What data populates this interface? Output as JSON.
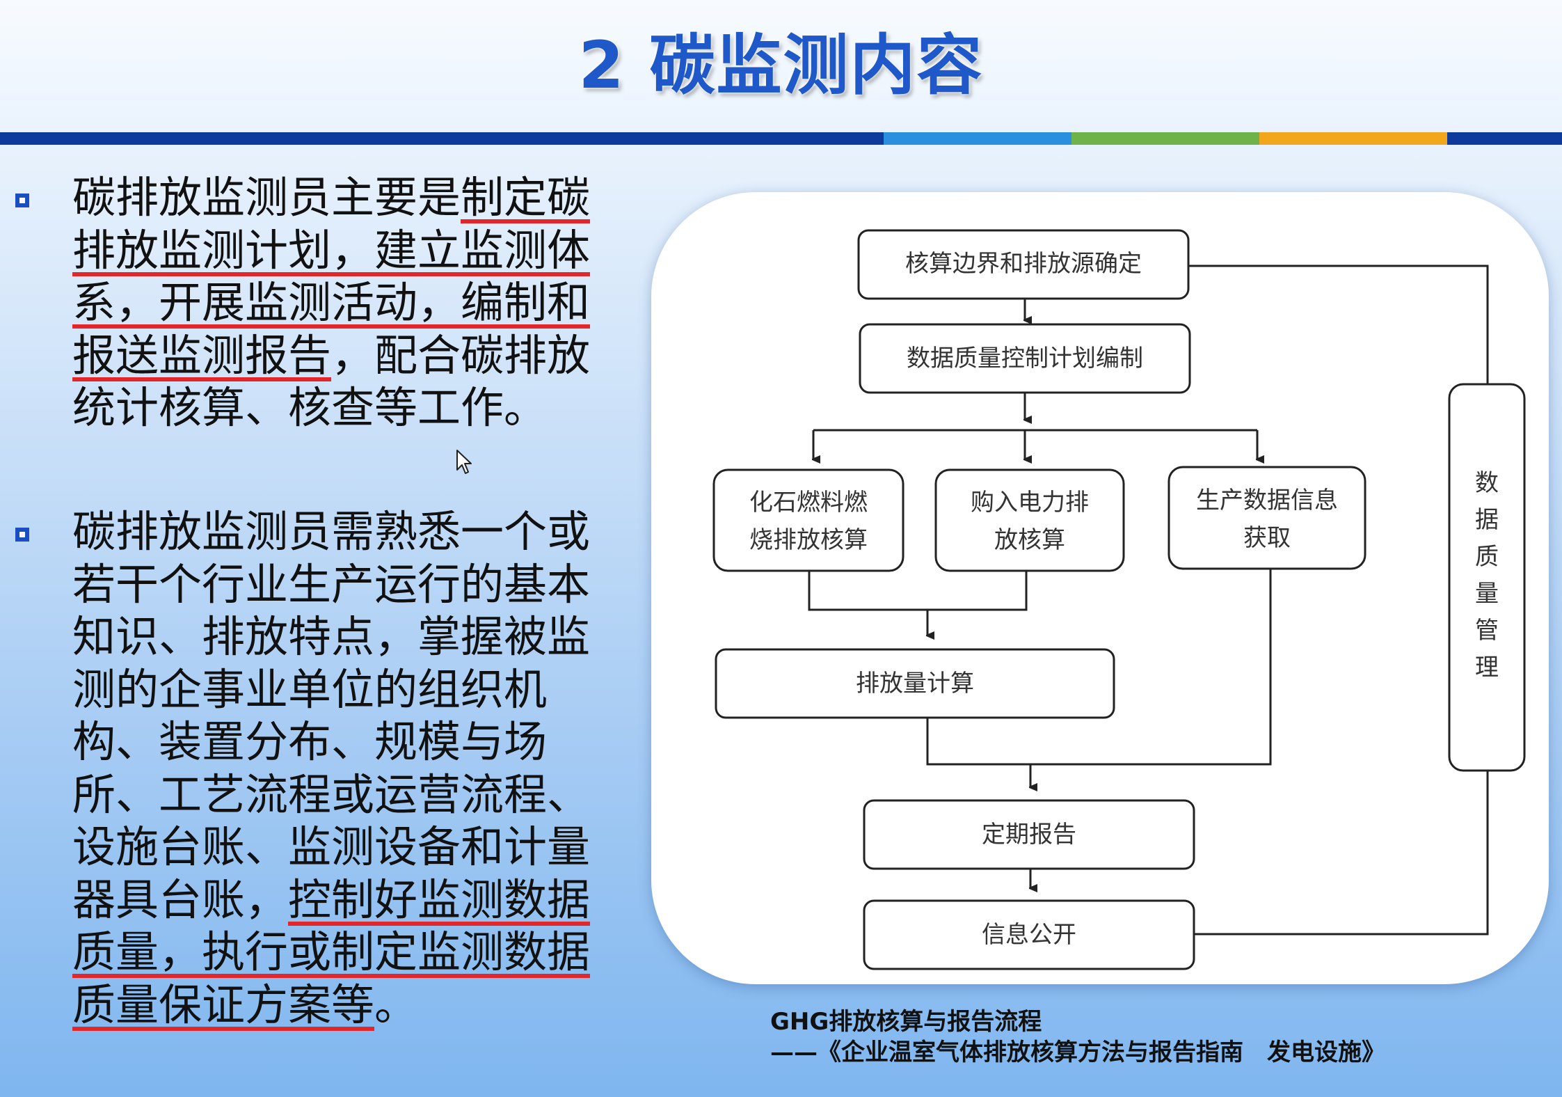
{
  "slide": {
    "title": "2 碳监测内容",
    "accent_colors": [
      "#0d3a9b",
      "#2b8fe0",
      "#6fb24a",
      "#f2a61c",
      "#0d3a9b"
    ]
  },
  "bullets": [
    {
      "segments": [
        {
          "text": "碳排放监测员主要是",
          "underline": false
        },
        {
          "text": "制定碳排放监测计划，建立监测体系，开展监测活动，编制和报送监测报告",
          "underline": true
        },
        {
          "text": "，配合碳排放统计核算、核查等工作。",
          "underline": false
        }
      ]
    },
    {
      "segments": [
        {
          "text": "碳排放监测员需熟悉一个或若干个行业生产运行的基本知识、排放特点，掌握被监测的企事业单位的组织机构、装置分布、规模与场所、工艺流程或运营流程、设施台账、监测设备和计量器具台账，",
          "underline": false
        },
        {
          "text": "控制好监测数据质量，执行或制定监测数据质量保证方案等",
          "underline": true
        },
        {
          "text": "。",
          "underline": false
        }
      ]
    }
  ],
  "flowchart": {
    "boundary": "核算边界和排放源确定",
    "plan": "数据质量控制计划编制",
    "fossil": [
      "化石燃料燃",
      "烧排放核算"
    ],
    "power": [
      "购入电力排",
      "放核算"
    ],
    "production": [
      "生产数据信息",
      "获取"
    ],
    "emission_calc": "排放量计算",
    "periodic_report": "定期报告",
    "disclosure": "信息公开",
    "quality_mgmt": [
      "数",
      "据",
      "质",
      "量",
      "管",
      "理"
    ]
  },
  "caption": {
    "line1": "GHG排放核算与报告流程",
    "line2": "——《企业温室气体排放核算方法与报告指南　发电设施》"
  }
}
